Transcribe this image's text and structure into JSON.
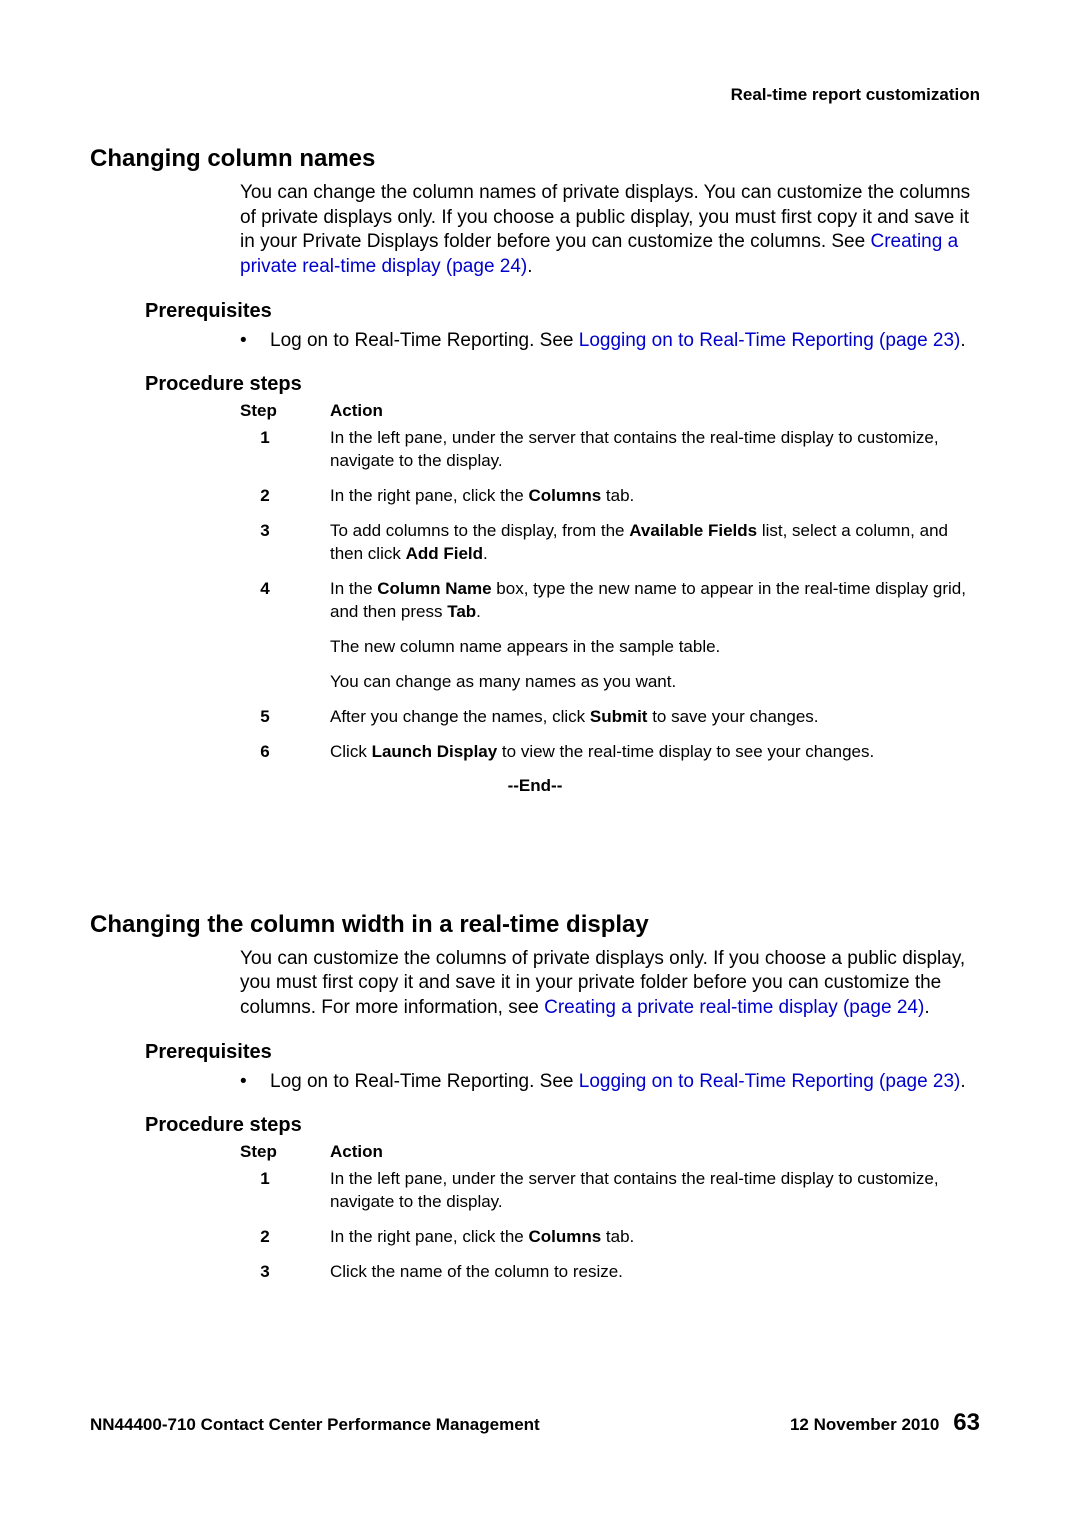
{
  "header": {
    "context": "Real-time report customization"
  },
  "section1": {
    "title": "Changing column names",
    "intro_pre": "You can change the column names of private displays. You can customize the columns of private displays only. If you choose a public display, you must first copy it and save it in your Private Displays folder before you can customize the columns. See ",
    "intro_link": "Creating a private real-time display (page 24)",
    "intro_post": ".",
    "prereq_heading": "Prerequisites",
    "prereq_text": "Log on to Real-Time Reporting. See ",
    "prereq_link": "Logging on to Real-Time Reporting (page 23)",
    "prereq_post": ".",
    "steps_heading": "Procedure steps",
    "col_step": "Step",
    "col_action": "Action",
    "steps": {
      "s1": {
        "num": "1",
        "text": "In the left pane, under the server that contains the real-time display to customize, navigate to the display."
      },
      "s2": {
        "num": "2",
        "pre": "In the right pane, click the ",
        "b1": "Columns",
        "post": " tab."
      },
      "s3": {
        "num": "3",
        "pre": "To add columns to the display, from the ",
        "b1": "Available Fields",
        "mid": " list, select a column, and then click ",
        "b2": "Add Field",
        "post": "."
      },
      "s4": {
        "num": "4",
        "p1_pre": "In the ",
        "p1_b1": "Column Name",
        "p1_mid": " box, type the new name to appear in the real-time display grid, and then press ",
        "p1_b2": "Tab",
        "p1_post": ".",
        "p2": "The new column name appears in the sample table.",
        "p3": "You can change as many names as you want."
      },
      "s5": {
        "num": "5",
        "pre": "After you change the names, click ",
        "b1": "Submit",
        "post": " to save your changes."
      },
      "s6": {
        "num": "6",
        "pre": "Click ",
        "b1": "Launch Display",
        "post": " to view the real-time display to see your changes."
      }
    },
    "end": "--End--"
  },
  "section2": {
    "title": "Changing the column width in a real-time display",
    "intro_pre": "You can customize the columns of private displays only. If you choose a public display, you must first copy it and save it in your private folder before you can customize the columns. For more information, see ",
    "intro_link": "Creating a private real-time display (page 24)",
    "intro_post": ".",
    "prereq_heading": "Prerequisites",
    "prereq_text": "Log on to Real-Time Reporting. See ",
    "prereq_link": "Logging on to Real-Time Reporting (page 23)",
    "prereq_post": ".",
    "steps_heading": "Procedure steps",
    "col_step": "Step",
    "col_action": "Action",
    "steps": {
      "s1": {
        "num": "1",
        "text": "In the left pane, under the server that contains the real-time display to customize, navigate to the display."
      },
      "s2": {
        "num": "2",
        "pre": "In the right pane, click the ",
        "b1": "Columns",
        "post": " tab."
      },
      "s3": {
        "num": "3",
        "text": "Click the name of the column to resize."
      }
    }
  },
  "footer": {
    "doc": "NN44400-710 Contact Center Performance Management",
    "date": "12 November 2010",
    "page": "63"
  }
}
